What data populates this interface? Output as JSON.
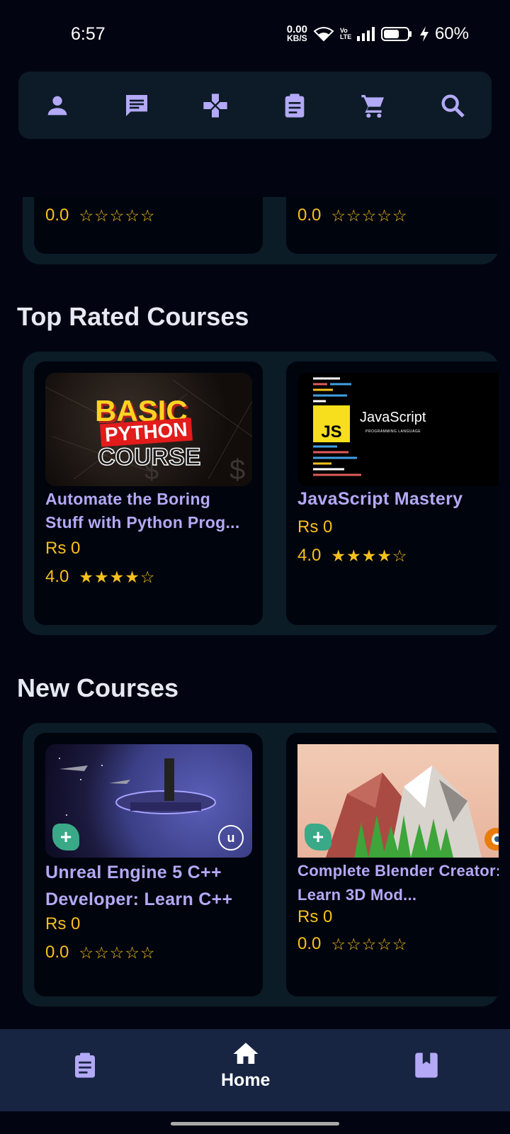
{
  "status_bar": {
    "time": "6:57",
    "net_speed_value": "0.00",
    "net_speed_unit": "KB/S",
    "volte": "Vo LTE",
    "battery": "60%"
  },
  "top_nav": {
    "icons": [
      "profile-icon",
      "chat-icon",
      "gamepad-icon",
      "clipboard-icon",
      "cart-icon",
      "search-icon"
    ]
  },
  "previous_row": {
    "cards": [
      {
        "rating": "0.0",
        "stars": "☆☆☆☆☆"
      },
      {
        "rating": "0.0",
        "stars": "☆☆☆☆☆"
      }
    ]
  },
  "top_rated": {
    "title": "Top Rated Courses",
    "cards": [
      {
        "thumb_line1": "BASIC",
        "thumb_line2": "PYTHON",
        "thumb_line3": "COURSE",
        "title": "Automate the Boring Stuff with Python Prog...",
        "price": "Rs 0",
        "rating": "4.0",
        "stars": "★★★★☆"
      },
      {
        "thumb_badge": "JS",
        "thumb_name": "JavaScript",
        "thumb_sub": "PROGRAMMING LANGUAGE",
        "title": "JavaScript Mastery",
        "price": "Rs 0",
        "rating": "4.0",
        "stars": "★★★★☆"
      }
    ]
  },
  "new_courses": {
    "title": "New Courses",
    "cards": [
      {
        "title": "Unreal Engine 5 C++ Developer: Learn C++",
        "price": "Rs 0",
        "rating": "0.0",
        "stars": "☆☆☆☆☆"
      },
      {
        "title": "Complete Blender Creator: Learn 3D Mod...",
        "price": "Rs 0",
        "rating": "0.0",
        "stars": "☆☆☆☆☆"
      }
    ]
  },
  "bottom_nav": {
    "home_label": "Home",
    "active": "home"
  },
  "colors": {
    "accent": "#b3a9f6",
    "star": "#f7c11c",
    "background": "#020511",
    "panel": "#0b1c27",
    "bottom_bar": "#172442"
  }
}
